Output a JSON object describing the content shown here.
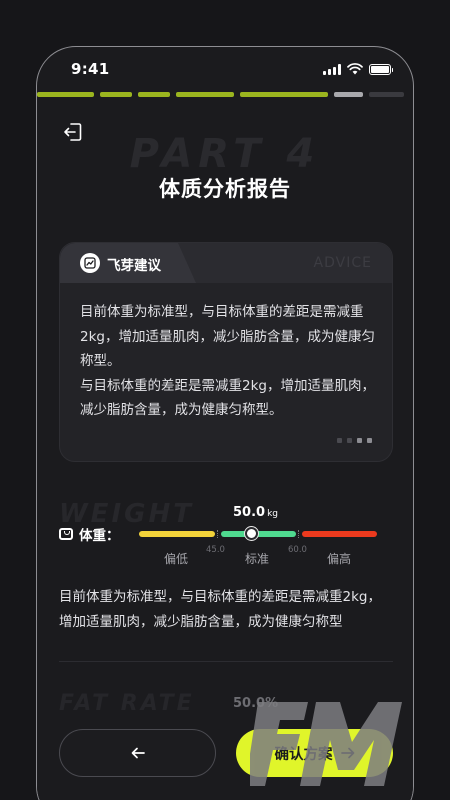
{
  "status": {
    "time": "9:41"
  },
  "progress": {
    "segments": [
      {
        "width": 57,
        "color": "#9bb51f"
      },
      {
        "width": 32,
        "color": "#9bb51f"
      },
      {
        "width": 32,
        "color": "#9bb51f"
      },
      {
        "width": 58,
        "color": "#9bb51f"
      },
      {
        "width": 88,
        "color": "#9bb51f"
      },
      {
        "width": 29,
        "color": "#a9a9ad"
      },
      {
        "width": 35,
        "color": "#3a3a3f"
      }
    ]
  },
  "header": {
    "bg_text": "PART 4",
    "title": "体质分析报告"
  },
  "advice_card": {
    "tab_label": "飞芽建议",
    "watermark": "ADVICE",
    "text": "目前体重为标准型，与目标体重的差距是需减重2kg，增加适量肌肉，减少脂肪含量，成为健康匀称型。\n与目标体重的差距是需减重2kg，增加适量肌肉，减少脂肪含量，成为健康匀称型。"
  },
  "weight": {
    "bg_text": "WEIGHT",
    "label": "体重：",
    "value": "50.0",
    "unit": "kg",
    "levels": [
      {
        "label": "偏低",
        "color": "#f3d33a"
      },
      {
        "label": "标准",
        "color": "#4fd98f"
      },
      {
        "label": "偏高",
        "color": "#ec3a1e"
      }
    ],
    "thresholds": [
      "45.0",
      "60.0"
    ],
    "description": "目前体重为标准型，与目标体重的差距是需减重2kg，增加适量肌肉，减少脂肪含量，成为健康匀称型"
  },
  "fat_rate": {
    "bg_text": "FAT RATE",
    "value": "50.0%"
  },
  "footer": {
    "back_icon": "arrow-left-icon",
    "confirm_label": "确认方案",
    "confirm_icon": "arrow-right-icon"
  }
}
